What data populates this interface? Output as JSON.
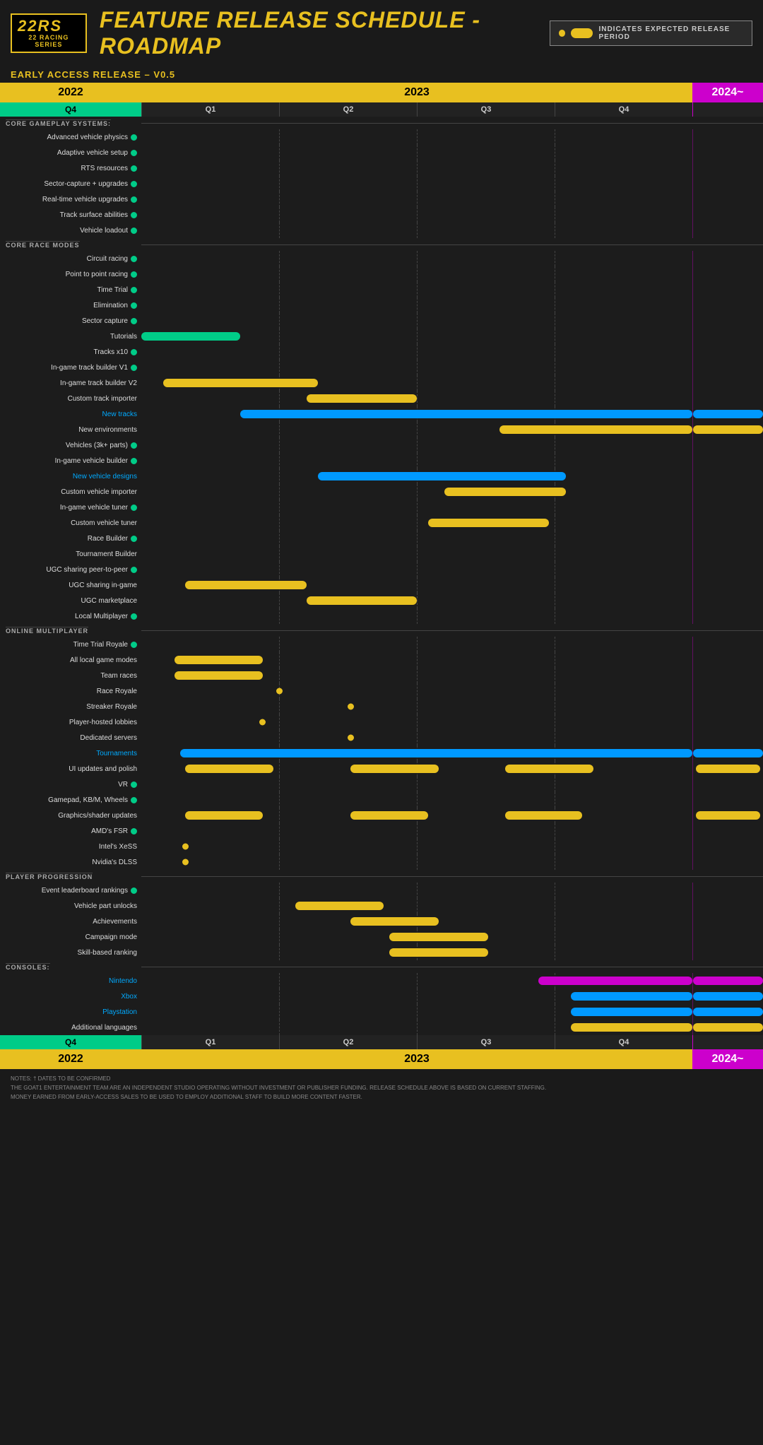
{
  "header": {
    "logo_line1": "22RS",
    "logo_line2": "22 RACING SERIES",
    "title": "FEATURE RELEASE SCHEDULE - ROADMAP",
    "legend_label": "INDICATES EXPECTED RELEASE PERIOD",
    "early_access": "EARLY ACCESS RELEASE – V0.5"
  },
  "timeline": {
    "year1": "2022",
    "year2": "2023",
    "year3": "2024~",
    "q1": "Q4",
    "q2": "Q1",
    "q3": "Q2",
    "q4": "Q3",
    "q5": "Q4"
  },
  "sections": [
    {
      "label": "CORE GAMEPLAY SYSTEMS:",
      "features": [
        {
          "name": "Advanced vehicle physics",
          "released": true,
          "bar": null
        },
        {
          "name": "Adaptive vehicle setup",
          "released": true,
          "bar": null
        },
        {
          "name": "RTS resources",
          "released": true,
          "bar": null
        },
        {
          "name": "Sector-capture + upgrades",
          "released": true,
          "bar": null
        },
        {
          "name": "Real-time vehicle upgrades",
          "released": true,
          "bar": null
        },
        {
          "name": "Track surface abilities",
          "released": true,
          "bar": null
        },
        {
          "name": "Vehicle loadout",
          "released": true,
          "bar": null
        }
      ]
    },
    {
      "label": "CORE RACE MODES",
      "features": [
        {
          "name": "Circuit racing",
          "released": true,
          "bar": null
        },
        {
          "name": "Point to point racing",
          "released": true,
          "bar": null
        },
        {
          "name": "Time Trial",
          "released": true,
          "bar": null
        },
        {
          "name": "Elimination",
          "released": true,
          "bar": null
        },
        {
          "name": "Sector capture",
          "released": true,
          "bar": null
        },
        {
          "name": "Tutorials",
          "released": false,
          "bar": {
            "color": "green",
            "start": 0,
            "width": 0.18
          }
        },
        {
          "name": "Tracks x10",
          "released": true,
          "bar": null
        },
        {
          "name": "In-game track builder V1",
          "released": true,
          "bar": null
        },
        {
          "name": "In-game track builder V2",
          "released": false,
          "bar": {
            "color": "yellow",
            "start": 0.04,
            "width": 0.28
          }
        },
        {
          "name": "Custom track importer",
          "released": false,
          "bar": {
            "color": "yellow",
            "start": 0.3,
            "width": 0.2
          }
        },
        {
          "name": "New tracks",
          "released": false,
          "color": "blue",
          "bar": {
            "color": "blue",
            "start": 0.18,
            "width": 0.82,
            "extends2024": true
          }
        },
        {
          "name": "New environments",
          "released": false,
          "bar": {
            "color": "yellow",
            "start": 0.65,
            "width": 0.35,
            "extends2024": true
          }
        },
        {
          "name": "Vehicles (3k+ parts)",
          "released": true,
          "bar": null
        },
        {
          "name": "In-game vehicle builder",
          "released": true,
          "bar": null
        },
        {
          "name": "New vehicle designs",
          "released": false,
          "color": "blue",
          "bar": {
            "color": "blue",
            "start": 0.32,
            "width": 0.45
          }
        },
        {
          "name": "Custom vehicle importer",
          "released": false,
          "bar": {
            "color": "yellow",
            "start": 0.55,
            "width": 0.22
          }
        },
        {
          "name": "In-game vehicle tuner",
          "released": true,
          "bar": null
        },
        {
          "name": "Custom vehicle tuner",
          "released": false,
          "bar": {
            "color": "yellow",
            "start": 0.52,
            "width": 0.22
          }
        },
        {
          "name": "Race Builder",
          "released": true,
          "bar": null
        },
        {
          "name": "Tournament Builder",
          "released": false,
          "bar": null
        },
        {
          "name": "UGC sharing peer-to-peer",
          "released": true,
          "bar": null
        },
        {
          "name": "UGC sharing in-game",
          "released": false,
          "bar": {
            "color": "yellow",
            "start": 0.08,
            "width": 0.22
          }
        },
        {
          "name": "UGC marketplace",
          "released": false,
          "bar": {
            "color": "yellow",
            "start": 0.3,
            "width": 0.2
          }
        },
        {
          "name": "Local Multiplayer",
          "released": true,
          "bar": null
        }
      ]
    },
    {
      "label": "ONLINE MULTIPLAYER",
      "features": [
        {
          "name": "Time Trial Royale",
          "released": true,
          "bar": null
        },
        {
          "name": "All local game modes",
          "released": false,
          "bar": {
            "color": "yellow",
            "start": 0.06,
            "width": 0.16
          }
        },
        {
          "name": "Team races",
          "released": false,
          "bar": {
            "color": "yellow",
            "start": 0.06,
            "width": 0.16
          }
        },
        {
          "name": "Race Royale",
          "released": false,
          "dot_only": true,
          "dot_pos": 0.25
        },
        {
          "name": "Streaker Royale",
          "released": false,
          "dot_only": true,
          "dot_pos": 0.38
        },
        {
          "name": "Player-hosted lobbies",
          "released": false,
          "dot_only": true,
          "dot_pos": 0.22
        },
        {
          "name": "Dedicated servers",
          "released": false,
          "dot_only": true,
          "dot_pos": 0.38
        },
        {
          "name": "Tournaments",
          "released": false,
          "color": "blue",
          "bar": {
            "color": "blue",
            "start": 0.07,
            "width": 0.93,
            "extends2024": true
          }
        }
      ]
    },
    {
      "label": null,
      "features": [
        {
          "name": "UI updates and polish",
          "released": false,
          "bar_multi": true
        },
        {
          "name": "VR",
          "released": true,
          "bar": null
        },
        {
          "name": "Gamepad, KB/M, Wheels",
          "released": true,
          "bar": null
        },
        {
          "name": "Graphics/shader updates",
          "released": false,
          "bar_multi": true
        }
      ]
    },
    {
      "label": null,
      "features": [
        {
          "name": "AMD's FSR",
          "released": true,
          "bar": null
        },
        {
          "name": "Intel's XeSS",
          "released": false,
          "dot_only": true,
          "dot_pos": 0.08
        },
        {
          "name": "Nvidia's DLSS",
          "released": false,
          "dot_only": true,
          "dot_pos": 0.08
        }
      ]
    },
    {
      "label": "PLAYER PROGRESSION",
      "features": [
        {
          "name": "Event leaderboard rankings",
          "released": true,
          "bar": null
        },
        {
          "name": "Vehicle part unlocks",
          "released": false,
          "bar": {
            "color": "yellow",
            "start": 0.28,
            "width": 0.16
          }
        },
        {
          "name": "Achievements",
          "released": false,
          "bar": {
            "color": "yellow",
            "start": 0.38,
            "width": 0.16
          }
        },
        {
          "name": "Campaign mode",
          "released": false,
          "bar": {
            "color": "yellow",
            "start": 0.45,
            "width": 0.18
          }
        },
        {
          "name": "Skill-based ranking",
          "released": false,
          "bar": {
            "color": "yellow",
            "start": 0.45,
            "width": 0.18
          }
        }
      ]
    },
    {
      "label": "CONSOLES:",
      "features": [
        {
          "name": "Nintendo",
          "color": "blue",
          "released": false,
          "dagger": true,
          "bar": {
            "color": "magenta",
            "start": 0.72,
            "width": 0.28,
            "extends2024": true
          }
        },
        {
          "name": "Xbox",
          "color": "blue",
          "released": false,
          "dagger": true,
          "bar": {
            "color": "blue",
            "start": 0.78,
            "width": 0.22,
            "extends2024": true
          }
        },
        {
          "name": "Playstation",
          "color": "blue",
          "released": false,
          "dagger": true,
          "bar": {
            "color": "blue",
            "start": 0.78,
            "width": 0.22,
            "extends2024": true
          }
        },
        {
          "name": "Additional languages",
          "released": false,
          "dagger": true,
          "bar": {
            "color": "yellow",
            "start": 0.78,
            "width": 0.22,
            "extends2024": true
          }
        }
      ]
    }
  ],
  "notes": {
    "line1": "NOTES: † DATES TO BE CONFIRMED",
    "line2": "THE GOAT1 ENTERTAINMENT TEAM ARE AN INDEPENDENT STUDIO OPERATING WITHOUT INVESTMENT OR PUBLISHER FUNDING. RELEASE SCHEDULE ABOVE IS BASED ON CURRENT STAFFING.",
    "line3": "MONEY EARNED FROM EARLY-ACCESS SALES TO BE USED TO EMPLOY ADDITIONAL STAFF TO BUILD MORE CONTENT FASTER."
  }
}
